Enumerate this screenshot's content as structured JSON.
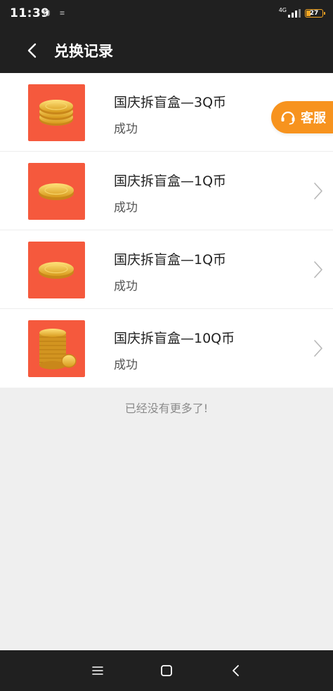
{
  "status_bar": {
    "time": "11:39",
    "network": "4G",
    "battery": "27",
    "colors": {
      "background": "#202020",
      "battery": "#f5a623"
    }
  },
  "header": {
    "back_icon": "chevron-left-icon",
    "title": "兑换记录"
  },
  "records": [
    {
      "title": "国庆拆盲盒—3Q币",
      "status": "成功",
      "coins": 3,
      "show_chevron": false
    },
    {
      "title": "国庆拆盲盒—1Q币",
      "status": "成功",
      "coins": 1,
      "show_chevron": true
    },
    {
      "title": "国庆拆盲盒—1Q币",
      "status": "成功",
      "coins": 1,
      "show_chevron": true
    },
    {
      "title": "国庆拆盲盒—10Q币",
      "status": "成功",
      "coins": 10,
      "show_chevron": true
    }
  ],
  "service": {
    "label": "客服",
    "icon": "headset-icon",
    "color": "#f7931e"
  },
  "footer": {
    "no_more_text": "已经没有更多了!"
  },
  "nav_bar": {
    "icons": [
      "menu-icon",
      "home-square-icon",
      "back-triangle-icon"
    ]
  },
  "theme": {
    "thumb_bg": "#f5593d",
    "coin_gold": "#f4c542"
  }
}
